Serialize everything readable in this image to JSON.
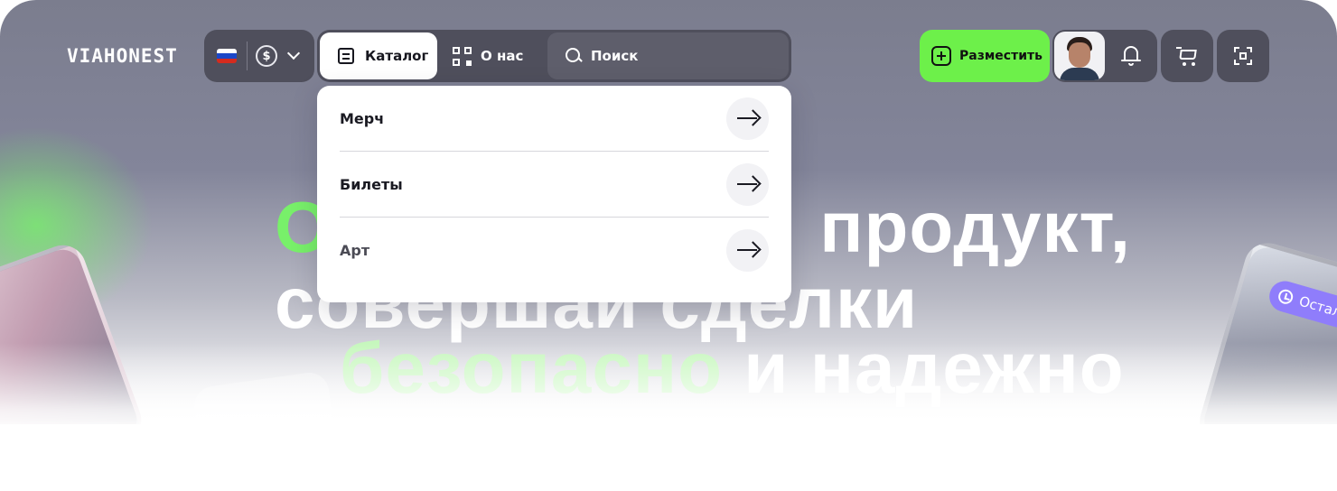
{
  "brand": {
    "logo": "VIAHONEST"
  },
  "locale": {
    "flag": "russia-flag-icon",
    "currency_symbol": "$"
  },
  "nav": {
    "catalog_label": "Каталог",
    "about_label": "О нас",
    "search_placeholder": "Поиск"
  },
  "actions": {
    "place_label": "Разместить"
  },
  "catalog_menu": {
    "items": [
      {
        "label": "Мерч"
      },
      {
        "label": "Билеты"
      },
      {
        "label": "Арт"
      }
    ]
  },
  "hero": {
    "line1_accent": "О",
    "line1_rest": "продукт,",
    "line2": "совершай сделки",
    "line3_accent": "безопасно",
    "line3_rest": "и надежно",
    "timer_badge": "Остал"
  },
  "colors": {
    "accent_green": "#6df04a",
    "header_bg": "#4f4f5c",
    "badge_purple": "#8f7dfb"
  }
}
